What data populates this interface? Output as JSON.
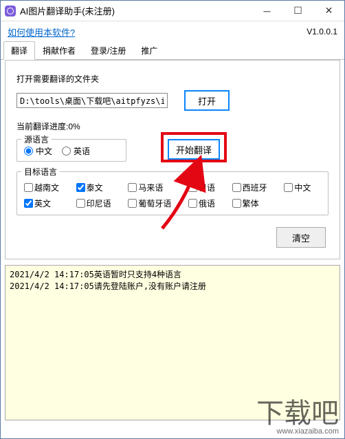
{
  "window": {
    "title": "AI图片翻译助手(未注册)"
  },
  "topbar": {
    "help_link": "如何使用本软件?",
    "version": "V1.0.0.1"
  },
  "tabs": {
    "items": [
      {
        "label": "翻译",
        "active": true
      },
      {
        "label": "捐献作者",
        "active": false
      },
      {
        "label": "登录/注册",
        "active": false
      },
      {
        "label": "推广",
        "active": false
      }
    ]
  },
  "main": {
    "folder_label": "打开需要翻译的文件夹",
    "folder_path": "D:\\tools\\桌面\\下载吧\\aitpfyzs\\im",
    "open_button": "打开",
    "progress_label": "当前翻译进度:0%",
    "src_lang_label": "源语言",
    "src_options": {
      "zh": "中文",
      "en": "英语"
    },
    "start_button": "开始翻译",
    "target_lang_label": "目标语言",
    "target_options": {
      "vi": "越南文",
      "th": "泰文",
      "ms": "马来语",
      "ja": "日语",
      "es": "西班牙",
      "zh": "中文",
      "en": "英文",
      "id": "印尼语",
      "pt": "葡萄牙语",
      "ru": "俄语",
      "zht": "繁体"
    },
    "target_checked": {
      "vi": false,
      "th": true,
      "ms": false,
      "ja": false,
      "es": false,
      "zh": false,
      "en": true,
      "id": false,
      "pt": false,
      "ru": false,
      "zht": false
    },
    "clear_button": "清空"
  },
  "log": {
    "lines": [
      "2021/4/2 14:17:05英语暂时只支持4种语言",
      "2021/4/2 14:17:05请先登陆账户,没有账户请注册"
    ]
  },
  "watermark": {
    "main": "下载吧",
    "sub": "www.xiazaiba.com"
  }
}
